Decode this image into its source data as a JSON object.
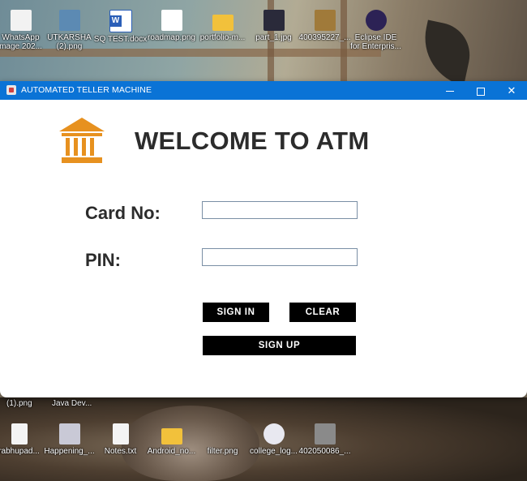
{
  "desktop": {
    "top_icons": [
      {
        "label": "WhatsApp",
        "label2": "mage 202...",
        "icon": "image-file-icon",
        "color": "#f2f2f2"
      },
      {
        "label": "UTKARSHA",
        "label2": "(2).png",
        "icon": "image-file-icon",
        "color": "#5c8ab3"
      },
      {
        "label": "SQ TEST.docx",
        "label2": "",
        "icon": "word-document-icon",
        "color": "#2b5fb8"
      },
      {
        "label": "roadmap.png",
        "label2": "",
        "icon": "image-file-icon",
        "color": "#ffffff"
      },
      {
        "label": "portfolio-m...",
        "label2": "",
        "icon": "folder-icon",
        "color": "#f2c13b"
      },
      {
        "label": "part_1.jpg",
        "label2": "",
        "icon": "image-file-icon",
        "color": "#2a2a3a"
      },
      {
        "label": "400395227_...",
        "label2": "",
        "icon": "image-file-icon",
        "color": "#a07a3a"
      },
      {
        "label": "Eclipse IDE",
        "label2": "for Enterpris...",
        "icon": "eclipse-icon",
        "color": "#2c2255"
      }
    ],
    "mid_labels": [
      "(1).png",
      "Java Dev..."
    ],
    "bottom_icons": [
      {
        "label": "rabhupad...",
        "icon": "text-file-icon",
        "color": "#f4f4f4"
      },
      {
        "label": "Happening_...",
        "icon": "image-file-icon",
        "color": "#c9c9d6"
      },
      {
        "label": "Notes.txt",
        "icon": "text-file-icon",
        "color": "#f4f4f4"
      },
      {
        "label": "Android_no...",
        "icon": "folder-icon",
        "color": "#f2c13b"
      },
      {
        "label": "filter.png",
        "icon": "image-file-icon",
        "color": "#8a6a4a"
      },
      {
        "label": "college_log...",
        "icon": "image-file-icon",
        "color": "#e8e8f0"
      },
      {
        "label": "402050086_...",
        "icon": "image-file-icon",
        "color": "#8a8a8a"
      }
    ]
  },
  "window": {
    "title": "AUTOMATED TELLER MACHINE",
    "titlebar_color": "#0a73d6",
    "close_glyph": "✕"
  },
  "form": {
    "heading": "WELCOME TO ATM",
    "icon": "bank-icon",
    "icon_color": "#e7911f",
    "card_label": "Card No:",
    "card_value": "",
    "pin_label": "PIN:",
    "pin_value": "",
    "sign_in_label": "SIGN IN",
    "clear_label": "CLEAR",
    "sign_up_label": "SIGN UP"
  }
}
